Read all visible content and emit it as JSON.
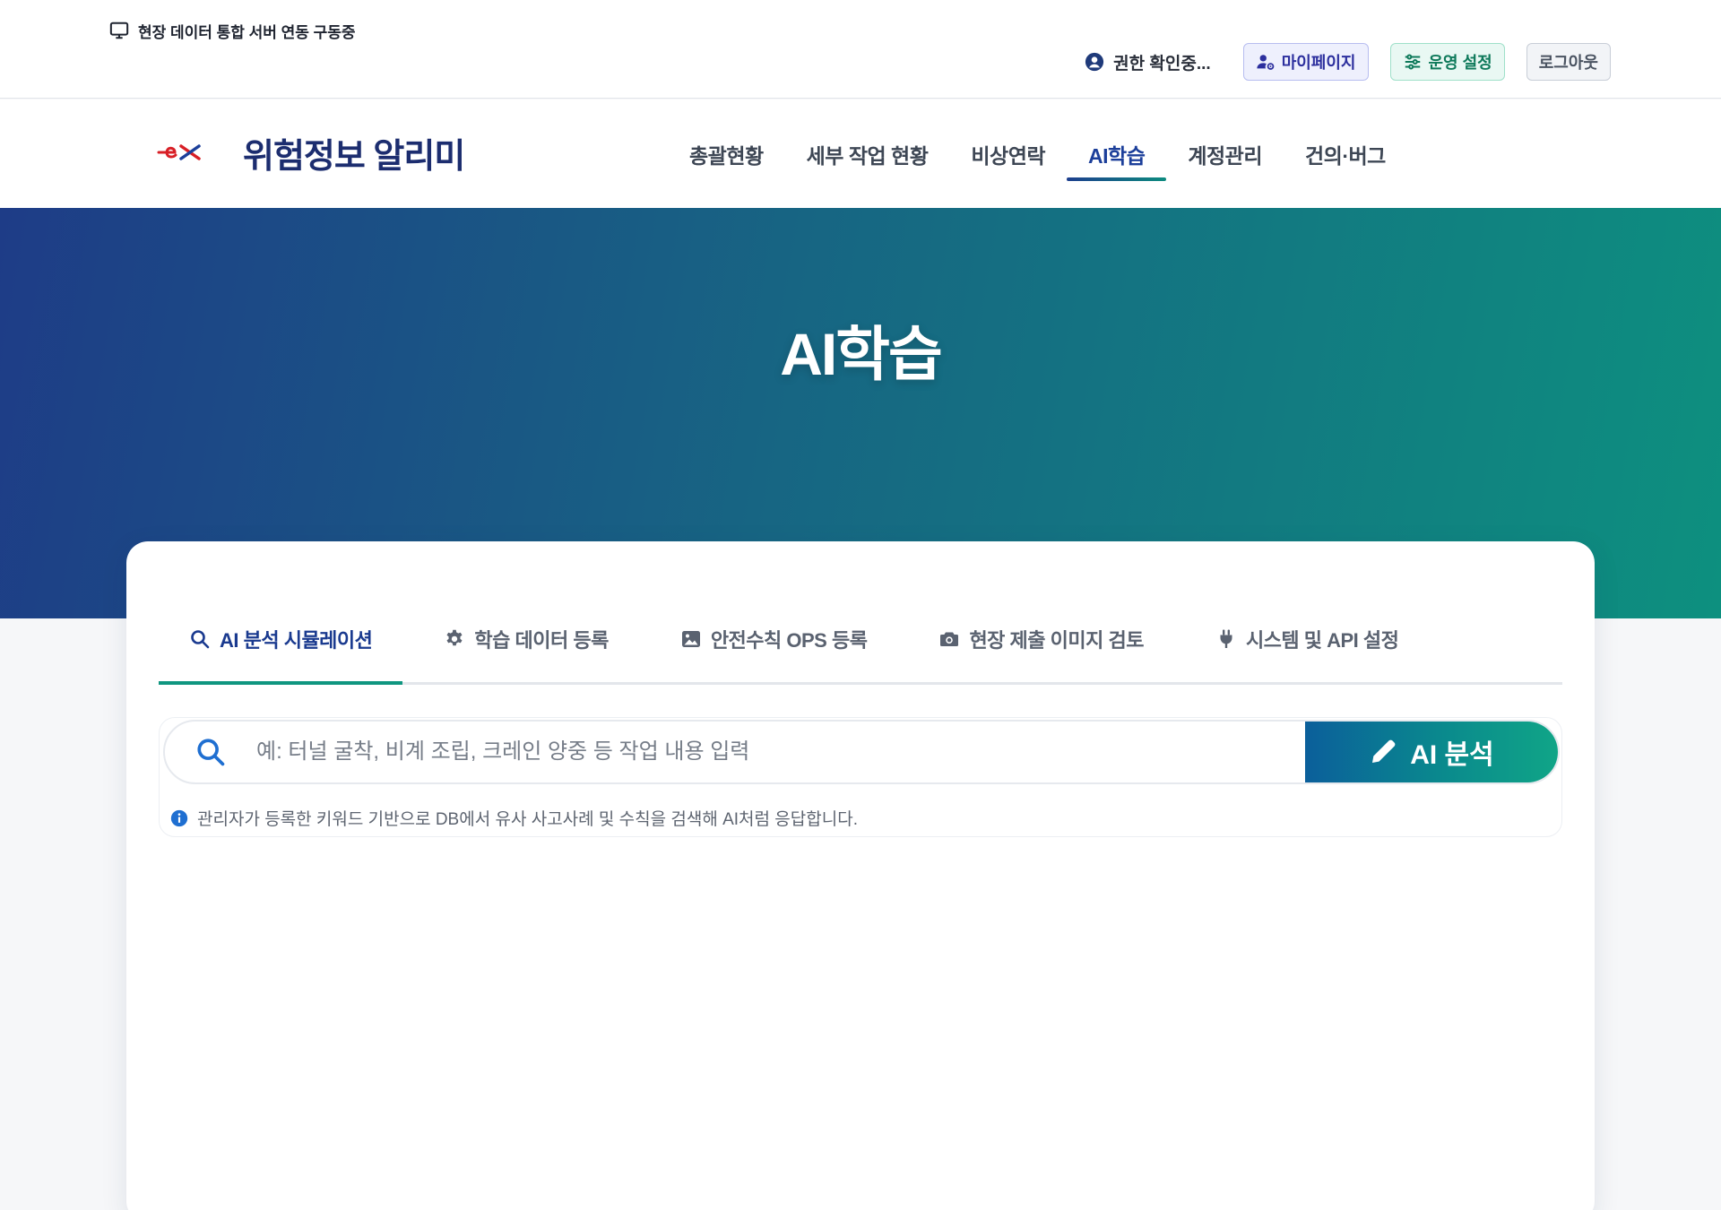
{
  "topbar": {
    "server_status": "현장 데이터 통합 서버 연동 구동중",
    "permission_status": "권한 확인중...",
    "mypage_label": "마이페이지",
    "ops_settings_label": "운영 설정",
    "logout_label": "로그아웃"
  },
  "header": {
    "app_title": "위험정보 알리미",
    "nav": [
      {
        "label": "총괄현황"
      },
      {
        "label": "세부 작업 현황"
      },
      {
        "label": "비상연락"
      },
      {
        "label": "AI학습"
      },
      {
        "label": "계정관리"
      },
      {
        "label": "건의·버그"
      }
    ],
    "active_nav_index": 3
  },
  "hero": {
    "title": "AI학습"
  },
  "tabs": [
    {
      "label": "AI 분석 시뮬레이션",
      "icon": "search-icon"
    },
    {
      "label": "학습 데이터 등록",
      "icon": "gear-icon"
    },
    {
      "label": "안전수칙 OPS 등록",
      "icon": "image-icon"
    },
    {
      "label": "현장 제출 이미지 검토",
      "icon": "camera-icon"
    },
    {
      "label": "시스템 및 API 설정",
      "icon": "plug-icon"
    }
  ],
  "active_tab_index": 0,
  "search": {
    "placeholder": "예: 터널 굴착, 비계 조립, 크레인 양중 등 작업 내용 입력",
    "value": "",
    "button_label": "AI 분석",
    "hint": "관리자가 등록한 키워드 기반으로 DB에서 유사 사고사례 및 수칙을 검색해 AI처럼 응답합니다."
  },
  "colors": {
    "primary": "#1c3f9a",
    "accent": "#0f9680",
    "hero_gradient_start": "#1e3c87",
    "hero_gradient_end": "#0d907f",
    "brand_red": "#d81f26"
  }
}
